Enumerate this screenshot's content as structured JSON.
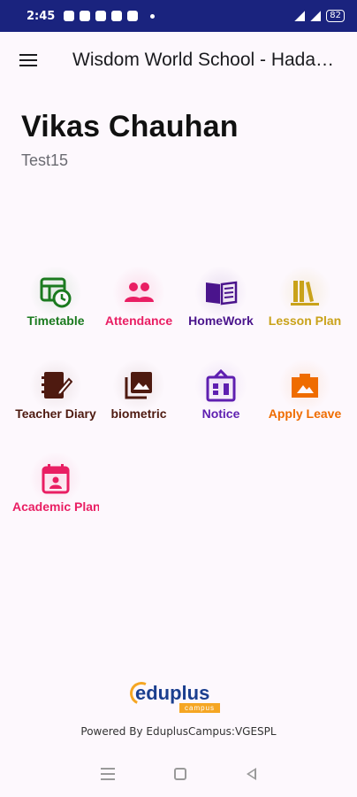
{
  "status_bar": {
    "time": "2:45",
    "battery": "82"
  },
  "app_bar": {
    "title": "Wisdom World School - Hadapsar"
  },
  "profile": {
    "name": "Vikas Chauhan",
    "subtitle": "Test15"
  },
  "tiles": [
    {
      "label": "Timetable",
      "color": "#1b7a1f",
      "icon": "timetable-icon"
    },
    {
      "label": "Attendance",
      "color": "#e91e63",
      "icon": "attendance-icon"
    },
    {
      "label": "HomeWork",
      "color": "#4a148c",
      "icon": "homework-icon"
    },
    {
      "label": "Lesson Plan",
      "color": "#c9a21a",
      "icon": "lesson-plan-icon"
    },
    {
      "label": "Teacher Diary",
      "color": "#4e1a10",
      "icon": "teacher-diary-icon"
    },
    {
      "label": "biometric",
      "color": "#4e1a10",
      "icon": "biometric-icon"
    },
    {
      "label": "Notice",
      "color": "#5e1fb0",
      "icon": "notice-icon"
    },
    {
      "label": "Apply Leave",
      "color": "#ef6c00",
      "icon": "apply-leave-icon"
    },
    {
      "label": "Academic Planner",
      "color": "#e91e63",
      "icon": "academic-planner-icon"
    }
  ],
  "footer": {
    "logo_word": "eduplus",
    "logo_badge": "campus",
    "powered_by": "Powered By EduplusCampus:VGESPL"
  }
}
